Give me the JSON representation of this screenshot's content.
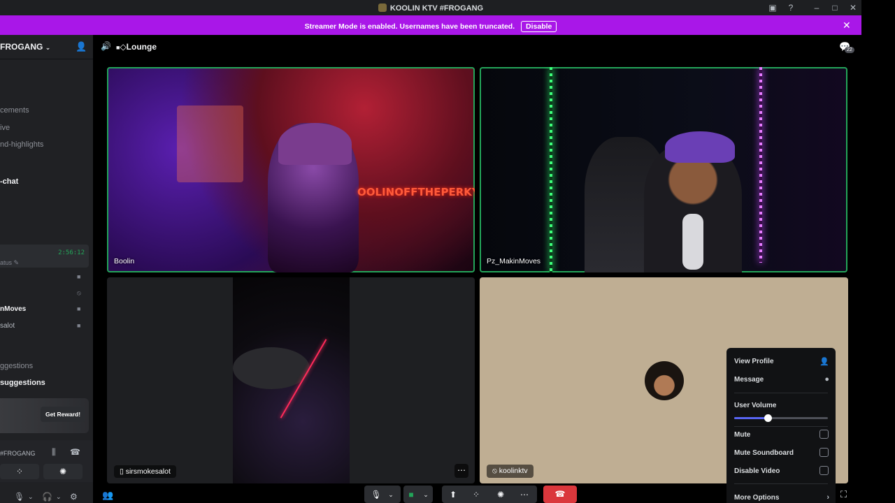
{
  "window": {
    "title": "KOOLIN KTV #FROGANG"
  },
  "banner": {
    "message": "Streamer Mode is enabled. Usernames have been truncated.",
    "disable_label": "Disable"
  },
  "sidebar": {
    "server_name": "FROGANG",
    "channels": [
      "cements",
      "ive",
      "nd-highlights",
      "-chat"
    ],
    "voice": {
      "timer": "2:56:12",
      "status": "atus",
      "users": [
        "nMoves",
        "salot"
      ]
    },
    "categories": [
      "ggestions",
      "suggestions"
    ],
    "reward_button": "Get Reward!",
    "rtc_name": "#FROGANG"
  },
  "header": {
    "channel": "◇Lounge",
    "chat_badge": "22"
  },
  "tiles": [
    {
      "name": "Boolin"
    },
    {
      "name": "Pz_MakinMoves"
    },
    {
      "name": "sirsmokesalot"
    },
    {
      "name": "koolinktv"
    }
  ],
  "video_text": {
    "neon_sign": "OOLINOFFTHEPERKY"
  },
  "menu": {
    "view_profile": "View Profile",
    "message": "Message",
    "user_volume": "User Volume",
    "volume_value": 0.36,
    "mute": "Mute",
    "mute_soundboard": "Mute Soundboard",
    "disable_video": "Disable Video",
    "more_options": "More Options"
  },
  "colors": {
    "accent": "#a917e8",
    "speaking": "#23a559",
    "leave": "#da373c",
    "blurple": "#5865f2"
  }
}
